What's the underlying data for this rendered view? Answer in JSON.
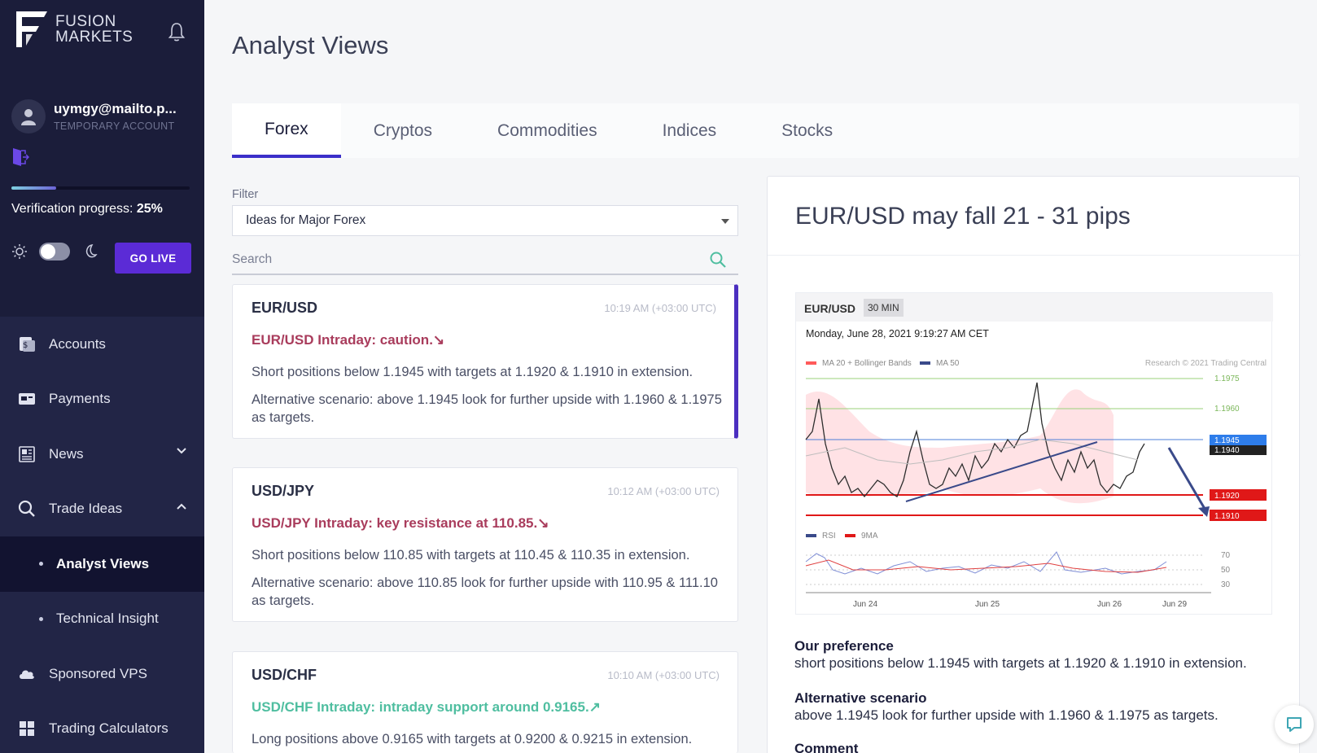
{
  "brand": {
    "line1": "FUSION",
    "line2": "MARKETS"
  },
  "user": {
    "email": "uymgy@mailto.p...",
    "type": "TEMPORARY ACCOUNT"
  },
  "verification": {
    "label": "Verification progress:",
    "value": "25%",
    "fraction": 0.25
  },
  "golive_label": "GO LIVE",
  "nav": {
    "accounts": "Accounts",
    "payments": "Payments",
    "news": "News",
    "trade_ideas": "Trade Ideas",
    "analyst_views": "Analyst Views",
    "technical_insight": "Technical Insight",
    "sponsored_vps": "Sponsored VPS",
    "trading_calculators": "Trading Calculators"
  },
  "page_title": "Analyst Views",
  "tabs": [
    "Forex",
    "Cryptos",
    "Commodities",
    "Indices",
    "Stocks"
  ],
  "filter": {
    "label": "Filter",
    "value": "Ideas for Major Forex"
  },
  "search": {
    "placeholder": "Search"
  },
  "ideas": [
    {
      "pair": "EUR/USD",
      "time": "10:19 AM (+03:00 UTC)",
      "headline": "EUR/USD Intraday: caution.↘",
      "p1": "Short positions below 1.1945 with targets at 1.1920 & 1.1910 in extension.",
      "p2": "Alternative scenario: above 1.1945 look for further upside with 1.1960 & 1.1975 as targets."
    },
    {
      "pair": "USD/JPY",
      "time": "10:12 AM (+03:00 UTC)",
      "headline": "USD/JPY Intraday: key resistance at 110.85.↘",
      "p1": "Short positions below 110.85 with targets at 110.45 & 110.35 in extension.",
      "p2": "Alternative scenario: above 110.85 look for further upside with 110.95 & 111.10 as targets."
    },
    {
      "pair": "USD/CHF",
      "time": "10:10 AM (+03:00 UTC)",
      "headline": "USD/CHF Intraday: intraday support around 0.9165.↗",
      "p1": "Long positions above 0.9165 with targets at 0.9200 & 0.9215 in extension."
    }
  ],
  "detail": {
    "title": "EUR/USD may fall 21 - 31 pips",
    "chart": {
      "symbol": "EUR/USD",
      "timeframe": "30 MIN",
      "date": "Monday, June 28, 2021 9:19:27 AM CET",
      "legend1": "MA 20 + Bollinger Bands",
      "legend2": "MA 50",
      "credit": "Research © 2021 Trading Central",
      "levels": [
        "1.1975",
        "1.1960",
        "1.1945",
        "1.1940",
        "1.1920",
        "1.1910"
      ],
      "rsi_legend1": "RSI",
      "rsi_legend2": "9MA",
      "rsi_levels": [
        "70",
        "50",
        "30"
      ],
      "dates": [
        "Jun 24",
        "Jun 25",
        "Jun 26",
        "Jun 29"
      ]
    },
    "pref_title": "Our preference",
    "pref_text": "short positions below 1.1945 with targets at 1.1920 & 1.1910 in extension.",
    "alt_title": "Alternative scenario",
    "alt_text": "above 1.1945 look for further upside with 1.1960 & 1.1975 as targets.",
    "comment_title": "Comment"
  },
  "colors": {
    "accent": "#3b2fc9",
    "golive": "#5b2bd6",
    "sidebar": "#1b1d3a",
    "bearish": "#a93c5c",
    "bullish": "#4fbea0"
  }
}
